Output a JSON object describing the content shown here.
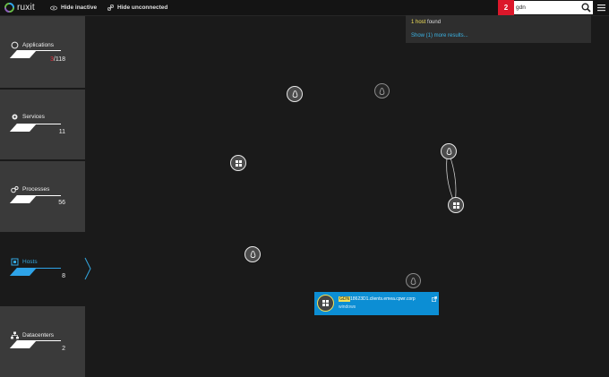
{
  "topbar": {
    "logo": "ruxit",
    "hide_inactive": "Hide inactive",
    "hide_unconnected": "Hide unconnected",
    "badge_count": "2",
    "search_value": "gdn"
  },
  "search_dropdown": {
    "found_highlight": "1 host",
    "found_rest": " found",
    "more_results": "Show (1) more results..."
  },
  "sidebar": {
    "applications": {
      "label": "Applications",
      "count_problem": "3",
      "count_total": "/118"
    },
    "services": {
      "label": "Services",
      "count": "11"
    },
    "processes": {
      "label": "Processes",
      "count": "56"
    },
    "hosts": {
      "label": "Hosts",
      "count": "8"
    },
    "datacenters": {
      "label": "Datacenters",
      "count": "2"
    }
  },
  "host_card": {
    "name_highlight": "GDN",
    "name_rest": "18623D1.clients.emea.cpwr.corp",
    "os": "windows"
  },
  "icons": {
    "linux": "linux-tux-icon",
    "windows": "windows-logo-icon",
    "search": "search-icon",
    "menu": "hamburger-menu-icon"
  },
  "colors": {
    "accent_blue": "#0c8ed4",
    "alert_red": "#dc172a",
    "highlight_yellow": "#f1e05a",
    "active_label": "#33a7e0"
  }
}
